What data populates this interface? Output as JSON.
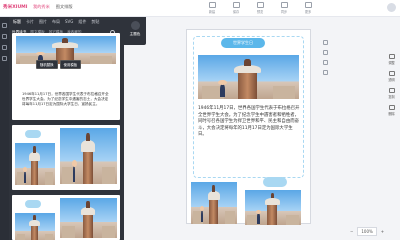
{
  "app": {
    "logo": "秀米XIUMI",
    "top_links": [
      "我的秀米",
      "图文排版"
    ],
    "tools": [
      {
        "icon": "plus-icon",
        "label": "新建"
      },
      {
        "icon": "save-icon",
        "label": "保存"
      },
      {
        "icon": "preview-icon",
        "label": "预览"
      },
      {
        "icon": "sync-icon",
        "label": "同步"
      },
      {
        "icon": "more-icon",
        "label": "更多"
      }
    ]
  },
  "panel": {
    "categories": [
      "标题",
      "卡片",
      "图片",
      "布局",
      "SVG",
      "组件",
      "剪贴"
    ],
    "subtabs": [
      "世界读书",
      "图文模板",
      "其它模板",
      "我收藏的"
    ],
    "sidetool_label": "主题色",
    "tpl_toolbar": [
      "随机替换",
      "使用模板"
    ],
    "tpl1_text": "1946年11月17日，世界各国学生代表于布拉格召开全世界学生大会。为了纪念学生中遇害的志士，大会决定将每年11月17日定为国际大学生日，宣扬民主。"
  },
  "canvas": {
    "title": "世界学生日",
    "body": "1946年11月17日，世界各国学生代表于布拉格召开全世界学生大会。为了纪念学生中遇害者和牺牲者，同时号召各国学生为捍卫世界和平、民主和自由而奋斗，大会决定将每年的11月17日定为国际大学生日。",
    "zoom": "100%"
  },
  "rtools": [
    "调整",
    "透明",
    "复制",
    "删除"
  ]
}
